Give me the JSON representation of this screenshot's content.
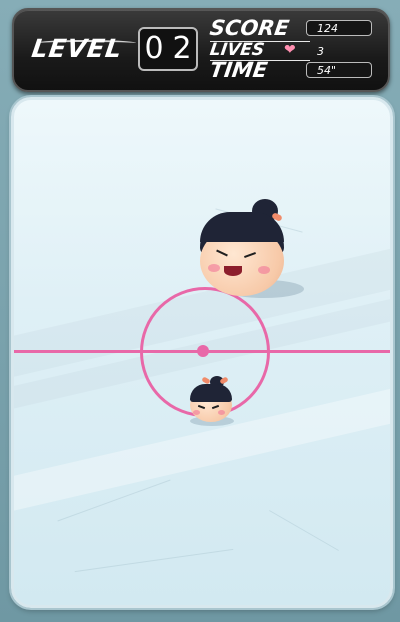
{
  "hud": {
    "level_label": "LEVEL",
    "level_digits": [
      "0",
      "2"
    ],
    "score_label": "SCORE",
    "score_value": "124",
    "lives_label": "LIVES",
    "lives_value": "3",
    "lives_icon": "heart-icon",
    "time_label": "TIME",
    "time_value": "54\""
  },
  "colors": {
    "rink_line": "#e868a8",
    "hud_bg": "#1a1a1a",
    "hair": "#1f2436",
    "background": "#7ea6b0"
  },
  "players": [
    {
      "name": "opponent",
      "icon": "opponent-head-icon"
    },
    {
      "name": "player",
      "icon": "player-head-icon"
    }
  ]
}
